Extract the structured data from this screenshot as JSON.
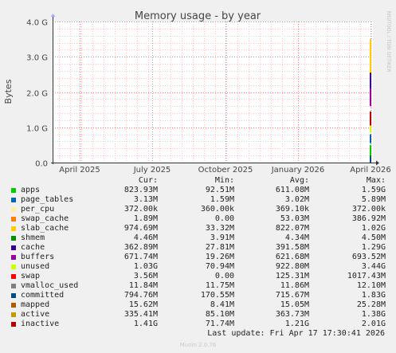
{
  "chart_data": {
    "type": "area",
    "title": "Memory usage - by year",
    "ylabel": "Bytes",
    "xlabel": "",
    "ylim": [
      0,
      4.0
    ],
    "y_unit": "G",
    "y_ticks": [
      "0.0",
      "1.0 G",
      "2.0 G",
      "3.0 G",
      "4.0 G"
    ],
    "x_ticks": [
      "April 2025",
      "July 2025",
      "October 2025",
      "January 2026",
      "April 2026"
    ],
    "grid": true,
    "legend_position": "bottom",
    "side_label": "RRDTOOL / TOBI OETIKER",
    "columns": [
      "Cur:",
      "Min:",
      "Avg:",
      "Max:"
    ],
    "series": [
      {
        "name": "apps",
        "color": "#00cc00",
        "cur": "823.93M",
        "min": "92.51M",
        "avg": "611.08M",
        "max": "1.59G"
      },
      {
        "name": "page_tables",
        "color": "#0066b3",
        "cur": "3.13M",
        "min": "1.59M",
        "avg": "3.02M",
        "max": "5.89M"
      },
      {
        "name": "per_cpu",
        "color": "#ffeea0",
        "cur": "372.00k",
        "min": "360.00k",
        "avg": "369.10k",
        "max": "372.00k"
      },
      {
        "name": "swap_cache",
        "color": "#ff8000",
        "cur": "1.89M",
        "min": "0.00",
        "avg": "53.03M",
        "max": "386.92M"
      },
      {
        "name": "slab_cache",
        "color": "#ffcc00",
        "cur": "974.69M",
        "min": "33.32M",
        "avg": "822.07M",
        "max": "1.02G"
      },
      {
        "name": "shmem",
        "color": "#008f00",
        "cur": "4.46M",
        "min": "3.91M",
        "avg": "4.34M",
        "max": "4.50M"
      },
      {
        "name": "cache",
        "color": "#330099",
        "cur": "362.89M",
        "min": "27.81M",
        "avg": "391.58M",
        "max": "1.29G"
      },
      {
        "name": "buffers",
        "color": "#990099",
        "cur": "671.74M",
        "min": "19.26M",
        "avg": "621.68M",
        "max": "693.52M"
      },
      {
        "name": "unused",
        "color": "#ccff00",
        "cur": "1.03G",
        "min": "70.94M",
        "avg": "922.80M",
        "max": "3.44G"
      },
      {
        "name": "swap",
        "color": "#ff0000",
        "cur": "3.56M",
        "min": "0.00",
        "avg": "125.31M",
        "max": "1017.43M"
      },
      {
        "name": "vmalloc_used",
        "color": "#808080",
        "cur": "11.84M",
        "min": "11.75M",
        "avg": "11.86M",
        "max": "12.10M"
      },
      {
        "name": "committed",
        "color": "#004d80",
        "cur": "794.76M",
        "min": "170.55M",
        "avg": "715.67M",
        "max": "1.83G"
      },
      {
        "name": "mapped",
        "color": "#b35a00",
        "cur": "15.62M",
        "min": "8.41M",
        "avg": "15.05M",
        "max": "25.28M"
      },
      {
        "name": "active",
        "color": "#c49a00",
        "cur": "335.41M",
        "min": "85.10M",
        "avg": "363.73M",
        "max": "1.38G"
      },
      {
        "name": "inactive",
        "color": "#b30000",
        "cur": "1.41G",
        "min": "71.74M",
        "avg": "1.21G",
        "max": "2.01G"
      }
    ]
  },
  "last_update": "Last update: Fri Apr 17 17:30:41 2026",
  "footer": "Munin 2.0.76"
}
